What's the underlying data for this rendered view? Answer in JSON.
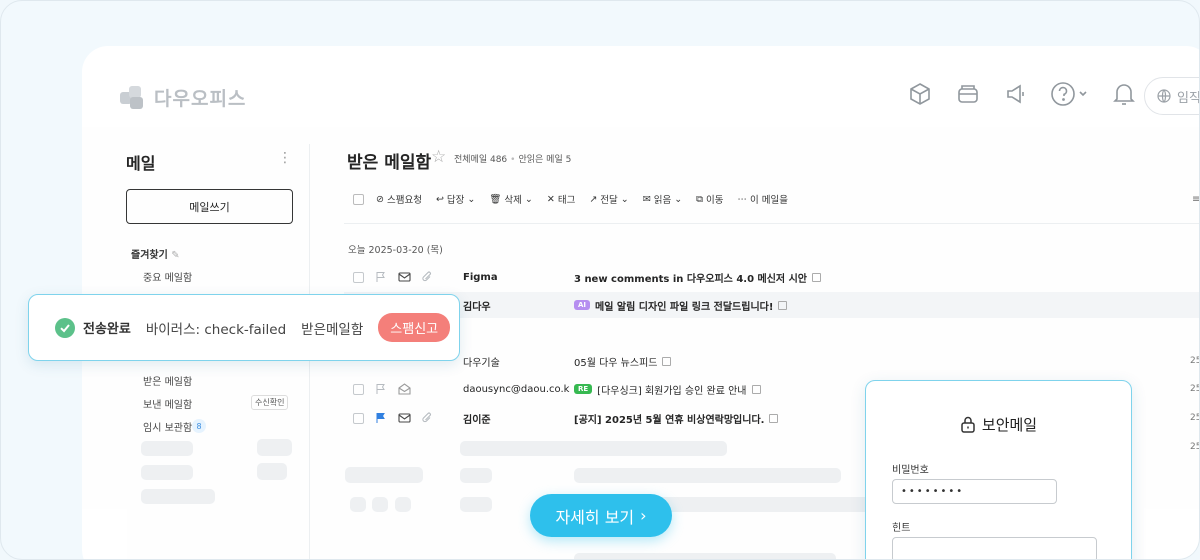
{
  "brand": {
    "name": "다우오피스"
  },
  "header": {
    "lang_label": "임직원"
  },
  "sidebar": {
    "title": "메일",
    "compose_label": "메일쓰기",
    "favorites_label": "즐겨찾기",
    "fav_items": [
      "중요 메일함"
    ],
    "items": [
      {
        "label": "받은 메일함"
      },
      {
        "label": "보낸 메일함",
        "badge": "수신확인"
      },
      {
        "label": "임시 보관함",
        "count": "8"
      }
    ]
  },
  "main": {
    "title": "받은 메일함",
    "total": "전체메일 486",
    "unread": "안읽은 메일 5",
    "toolbar": [
      "스팸요청",
      "답장",
      "삭제",
      "태그",
      "전달",
      "읽음",
      "이동",
      "이 메일을"
    ],
    "date_group": "오늘 2025-03-20 (목)",
    "rows": [
      {
        "sender": "Figma",
        "subject": "3 new comments in 다우오피스 4.0 메신저 시안",
        "tag": "",
        "date": ""
      },
      {
        "sender": "김다우",
        "subject": "메일 알림 디자인 파일 링크 전달드립니다!",
        "tag": "AI",
        "date": ""
      },
      {
        "sender": "다우기술",
        "subject": "05월 다우 뉴스피드",
        "tag": "",
        "date": "25"
      },
      {
        "sender": "daousync@daou.co.k",
        "subject": "[다우싱크] 회원가입 승인 완료 안내",
        "tag": "RE",
        "date": "25"
      },
      {
        "sender": "김이준",
        "subject": "[공지] 2025년 5월 연휴 비상연락망입니다.",
        "tag": "",
        "date": "25"
      }
    ],
    "extra_date": "25"
  },
  "toast": {
    "status": "전송완료",
    "virus": "바이러스: check-failed",
    "folder": "받은메일함",
    "spam_button": "스팸신고"
  },
  "cta": {
    "label": "자세히 보기"
  },
  "secure_mail": {
    "title": "보안메일",
    "password_label": "비밀번호",
    "password_value": "••••••••",
    "hint_label": "힌트"
  },
  "colors": {
    "accent": "#2ec0ec",
    "spam": "#f47f7a",
    "success": "#5cc18a",
    "ai_tag": "#b68df0",
    "re_tag": "#35b84f",
    "flag_blue": "#2e7fe0"
  }
}
